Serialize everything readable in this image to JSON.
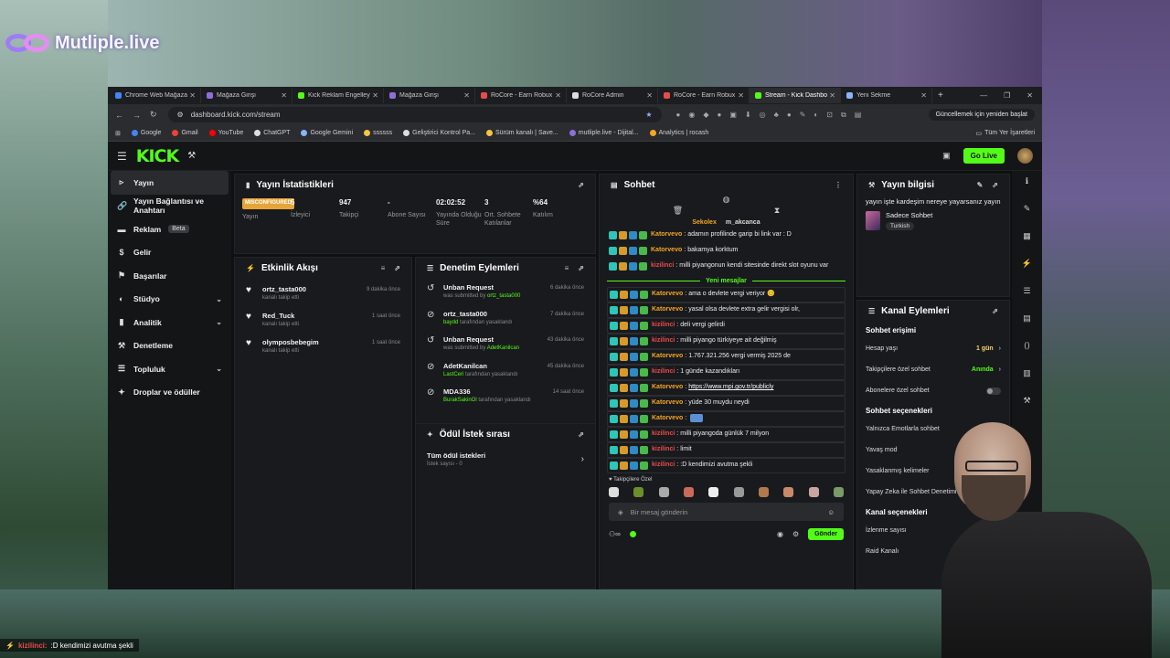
{
  "overlay": {
    "brand": "Mutliple.live",
    "ticker_user": "kizilinci:",
    "ticker_text": ":D kendimizi avutma şekli"
  },
  "browser": {
    "tabs": [
      {
        "title": "Chrome Web Mağaza",
        "color": "#4285f4"
      },
      {
        "title": "Mağaza Girişi",
        "color": "#8e6fd8"
      },
      {
        "title": "Kick Reklam Engelley",
        "color": "#53fc18"
      },
      {
        "title": "Mağaza Girişi",
        "color": "#8e6fd8"
      },
      {
        "title": "RoCore - Earn Robux",
        "color": "#e84b4b"
      },
      {
        "title": "RoCore Admin",
        "color": "#dddddd"
      },
      {
        "title": "RoCore - Earn Robux",
        "color": "#e84b4b"
      },
      {
        "title": "Stream - Kick Dashbo",
        "color": "#53fc18"
      },
      {
        "title": "Yeni Sekme",
        "color": "#8ab4f8"
      }
    ],
    "url": "dashboard.kick.com/stream",
    "update_label": "Güncellemek için yeniden başlat",
    "bookmarks": [
      {
        "label": "Google",
        "color": "#4285f4"
      },
      {
        "label": "Gmail",
        "color": "#ea4335"
      },
      {
        "label": "YouTube",
        "color": "#ff0000"
      },
      {
        "label": "ChatGPT",
        "color": "#dddddd"
      },
      {
        "label": "Google Gemini",
        "color": "#8ab4f8"
      },
      {
        "label": "ssssss",
        "color": "#f5c542"
      },
      {
        "label": "Geliştirici Kontrol Pa...",
        "color": "#dddddd"
      },
      {
        "label": "Sürüm kanalı | Save...",
        "color": "#f5c542"
      },
      {
        "label": "mutliple.live - Dijital...",
        "color": "#8e6fd8"
      },
      {
        "label": "Analytics | rocash",
        "color": "#f5a623"
      }
    ],
    "bookmarks_all": "Tüm Yer İşaretleri"
  },
  "kick": {
    "logo": "KICK",
    "live_button": "Go Live",
    "sidebar": [
      {
        "label": "Yayın",
        "icon": "▹",
        "chev": false,
        "active": true
      },
      {
        "label": "Yayın Bağlantısı ve Anahtarı",
        "icon": "🔗",
        "chev": false
      },
      {
        "label": "Reklam",
        "icon": "▬",
        "chev": false,
        "beta": "Beta"
      },
      {
        "label": "Gelir",
        "icon": "$",
        "chev": false
      },
      {
        "label": "Başarılar",
        "icon": "⚑",
        "chev": false
      },
      {
        "label": "Stüdyo",
        "icon": "◐",
        "chev": true
      },
      {
        "label": "Analitik",
        "icon": "▮",
        "chev": true
      },
      {
        "label": "Denetleme",
        "icon": "⚒",
        "chev": false
      },
      {
        "label": "Topluluk",
        "icon": "☰",
        "chev": true
      },
      {
        "label": "Droplar ve ödüller",
        "icon": "✦",
        "chev": false
      }
    ],
    "stats": {
      "title": "Yayın İstatistikleri",
      "items": [
        {
          "value": "MISCONFIGURED",
          "label": "Yayın"
        },
        {
          "value": "5",
          "label": "İzleyici"
        },
        {
          "value": "947",
          "label": "Takipçi"
        },
        {
          "value": "-",
          "label": "Abone Sayısı"
        },
        {
          "value": "02:02:52",
          "label": "Yayında Olduğu Süre"
        },
        {
          "value": "3",
          "label": "Ort. Sohbete Katılanlar"
        },
        {
          "value": "%64",
          "label": "Katılım"
        }
      ]
    },
    "activity": {
      "title": "Etkinlik Akışı",
      "items": [
        {
          "name": "ortz_tasta000",
          "sub": "kanalı takip etti",
          "time": "9 dakika önce"
        },
        {
          "name": "Red_Tuck",
          "sub": "kanalı takip etti",
          "time": "1 saat önce"
        },
        {
          "name": "olymposbebegim",
          "sub": "kanalı takip etti",
          "time": "1 saat önce"
        }
      ]
    },
    "moderation": {
      "title": "Denetim Eylemleri",
      "items": [
        {
          "icon": "↺",
          "name": "Unban Request",
          "sub_pre": "was submitted by ",
          "sub_user": "ortz_tasta000",
          "sub_post": "",
          "time": "6 dakika önce"
        },
        {
          "icon": "⊘",
          "name": "ortz_tasta000",
          "sub_pre": "",
          "sub_user": "baydd",
          "sub_post": " tarafından yasaklandı",
          "time": "7 dakika önce"
        },
        {
          "icon": "↺",
          "name": "Unban Request",
          "sub_pre": "was submitted by ",
          "sub_user": "AdetKanilcan",
          "sub_post": "",
          "time": "43 dakika önce"
        },
        {
          "icon": "⊘",
          "name": "AdetKanilcan",
          "sub_pre": "",
          "sub_user": "LastCeri",
          "sub_post": " tarafından yasaklandı",
          "time": "45 dakika önce"
        },
        {
          "icon": "⊘",
          "name": "MDA336",
          "sub_pre": "",
          "sub_user": "BurakSakinOl",
          "sub_post": " tarafından yasaklandı",
          "time": "14 saat önce"
        }
      ]
    },
    "rewards": {
      "title": "Ödül İstek sırası",
      "item": "Tüm ödül istekleri",
      "sub": "İstek sayısı - 0"
    },
    "chat": {
      "title": "Sohbet",
      "pinned": [
        {
          "name": "Sekolex",
          "color": "#f5a623"
        },
        {
          "name": "m_akcanca",
          "color": "#dddddd"
        }
      ],
      "old": [
        {
          "user": "Katorvevo",
          "cls": "u-kat",
          "text": "adamın profilinde garip bi link var : D"
        },
        {
          "user": "Katorvevo",
          "cls": "u-kat",
          "text": "bakamya korktum"
        },
        {
          "user": "kizilinci",
          "cls": "u-kiz",
          "text": "milli piyangonun kendi sitesinde direkt slot oyunu var"
        }
      ],
      "new_label": "Yeni mesajlar",
      "new": [
        {
          "user": "Katorvevo",
          "cls": "u-kat",
          "text": "ama o devlete vergi veriyor 😊"
        },
        {
          "user": "Katorvevo",
          "cls": "u-kat",
          "text": "yasal olsa devlete extra gelir vergisi olr,"
        },
        {
          "user": "kizilinci",
          "cls": "u-kiz",
          "text": "deli vergi gelirdi"
        },
        {
          "user": "kizilinci",
          "cls": "u-kiz",
          "text": "milli piyango türkiyeye ait değilmiş"
        },
        {
          "user": "Katorvevo",
          "cls": "u-kat",
          "text": "1.767.321.256 vergi vermiş 2025 de"
        },
        {
          "user": "kizilinci",
          "cls": "u-kiz",
          "text": "1 günde kazandıkları"
        },
        {
          "user": "Katorvevo",
          "cls": "u-kat",
          "text": "https://www.mpi.gov.tr/publicly",
          "link": true
        },
        {
          "user": "Katorvevo",
          "cls": "u-kat",
          "text": "yüde 30 muydu neydi"
        },
        {
          "user": "Katorvevo",
          "cls": "u-kat",
          "text": "",
          "emote": true
        },
        {
          "user": "kizilinci",
          "cls": "u-kiz",
          "text": "milli piyangoda günlük 7 milyon"
        },
        {
          "user": "kizilinci",
          "cls": "u-kiz",
          "text": "limit"
        },
        {
          "user": "kizilinci",
          "cls": "u-kiz",
          "text": ":D kendimizi avutma şekli"
        }
      ],
      "subs_label": "Takipçilere Özel",
      "emote_colors": [
        "#dddddd",
        "#6b8f2a",
        "#aaaaaa",
        "#c96a5a",
        "#eeeeee",
        "#999999",
        "#b07a4a",
        "#c98a6a",
        "#c9a6a0",
        "#7a9a6a"
      ],
      "placeholder": "Bir mesaj gönderin",
      "send": "Gönder"
    },
    "info": {
      "title": "Yayın bilgisi",
      "desc": "yayın işte kardeşim nereye yayarsanız yayın",
      "category": "Sadece Sohbet",
      "tag": "Turkish"
    },
    "channel": {
      "title": "Kanal Eylemleri",
      "access_title": "Sohbet erişimi",
      "access": [
        {
          "label": "Hesap yaşı",
          "value": "1 gün",
          "cls": "y"
        },
        {
          "label": "Takipçilere özel sohbet",
          "value": "Anında",
          "cls": "g"
        },
        {
          "label": "Abonelere özel sohbet",
          "value": "",
          "toggle": true
        }
      ],
      "opts_title": "Sohbet seçenekleri",
      "opts": [
        "Yalnızca Emotlarla sohbet",
        "Yavaş mod",
        "Yasaklanmış kelimeler",
        "Yapay Zeka ile Sohbet Denetimi"
      ],
      "chan_title": "Kanal seçenekleri",
      "chan": [
        "İzlenme sayısı",
        "Raid Kanalı"
      ]
    }
  }
}
